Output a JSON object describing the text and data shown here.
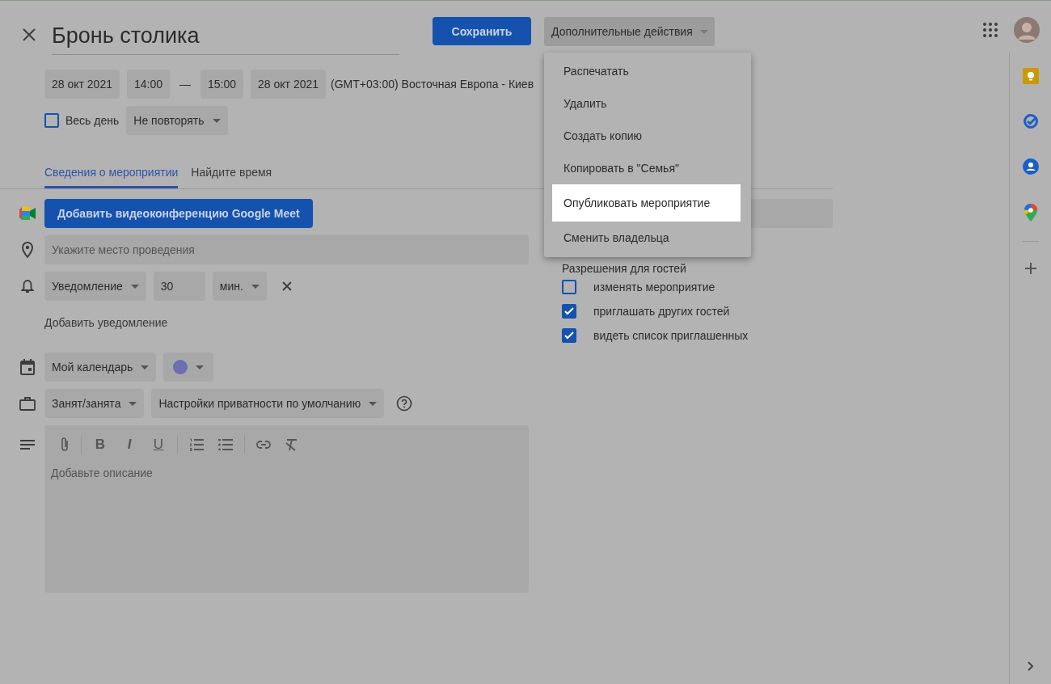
{
  "header": {
    "title": "Бронь столика",
    "save_button": "Сохранить",
    "more_actions": "Дополнительные действия"
  },
  "menu": {
    "items": [
      {
        "label": "Распечатать",
        "selected": false
      },
      {
        "label": "Удалить",
        "selected": false
      },
      {
        "label": "Создать копию",
        "selected": false
      },
      {
        "label": "Копировать в \"Семья\"",
        "selected": false
      },
      {
        "label": "Опубликовать мероприятие",
        "selected": true
      },
      {
        "label": "Сменить владельца",
        "selected": false
      }
    ]
  },
  "datetime": {
    "start_date": "28 окт 2021",
    "start_time": "14:00",
    "dash": "—",
    "end_time": "15:00",
    "end_date": "28 окт 2021",
    "timezone": "(GMT+03:00) Восточная Европа - Киев"
  },
  "all_day": {
    "label": "Весь день",
    "checked": false
  },
  "repeat": "Не повторять",
  "tabs": [
    {
      "label": "Сведения о мероприятии",
      "selected": true
    },
    {
      "label": "Найдите время",
      "selected": false
    }
  ],
  "meet_button": "Добавить видеоконференцию Google Meet",
  "location": {
    "placeholder": "Укажите место проведения"
  },
  "notification": {
    "type": "Уведомление",
    "value": "30",
    "unit": "мин."
  },
  "add_notification": "Добавить уведомление",
  "calendar": {
    "name": "Мой календарь",
    "color": "#6a6fb0"
  },
  "availability": "Занят/занята",
  "privacy": "Настройки приватности по умолчанию",
  "format_buttons": [
    {
      "label": "B",
      "kind": "bold"
    },
    {
      "label": "I",
      "kind": "italic"
    },
    {
      "label": "U",
      "kind": "underline"
    }
  ],
  "description": {
    "placeholder": "Добавьте описание"
  },
  "guest_permissions": {
    "title": "Разрешения для гостей",
    "items": [
      {
        "label": "изменять мероприятие",
        "checked": false
      },
      {
        "label": "приглашать других гостей",
        "checked": true
      },
      {
        "label": "видеть список приглашенных",
        "checked": true
      }
    ]
  }
}
